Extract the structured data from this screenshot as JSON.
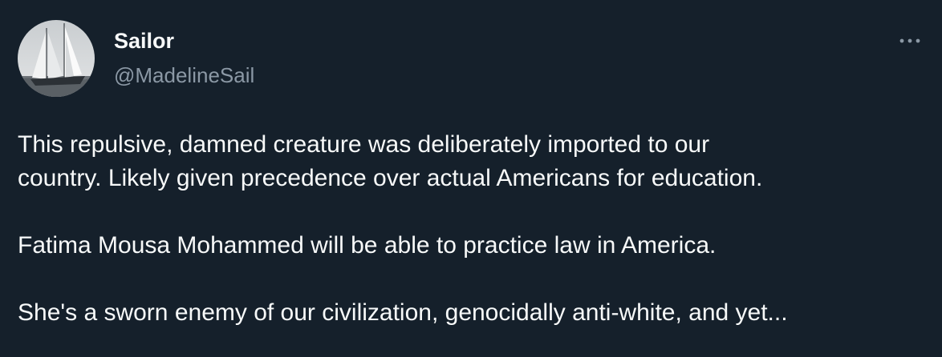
{
  "author": {
    "display_name": "Sailor",
    "handle": "@MadelineSail",
    "avatar_icon": "sailboat-avatar"
  },
  "menu": {
    "more_icon": "more-horizontal-icon"
  },
  "tweet": {
    "lines": [
      "This repulsive, damned creature was deliberately imported to our",
      "country. Likely given precedence over actual Americans for education.",
      "Fatima Mousa Mohammed will be able to practice law in America.",
      "She's a sworn enemy of our civilization, genocidally anti-white, and yet..."
    ]
  },
  "colors": {
    "background": "#15202b",
    "primary_text": "#f7f9f9",
    "secondary_text": "#8b98a5"
  }
}
